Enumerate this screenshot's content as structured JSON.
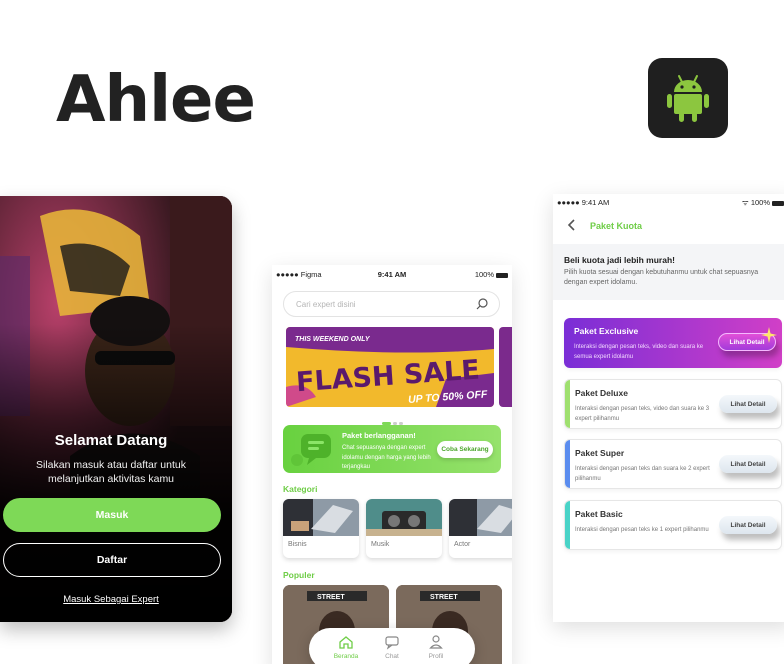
{
  "app_title": "Ahlee",
  "platform_icon": "android-icon",
  "colors": {
    "accent_green": "#7ed957",
    "exclusive_purple": "#9b36d4"
  },
  "welcome_screen": {
    "title": "Selamat Datang",
    "subtitle": "Silakan masuk atau daftar untuk melanjutkan aktivitas kamu",
    "login_button": "Masuk",
    "register_button": "Daftar",
    "expert_link": "Masuk Sebagai Expert"
  },
  "home_screen": {
    "status": {
      "carrier": "Figma",
      "time": "9:41 AM",
      "battery": "100%"
    },
    "search_placeholder": "Cari expert disini",
    "banner": {
      "tag": "THIS WEEKEND ONLY",
      "headline": "FLASH SALE",
      "discount": "UP TO 50% OFF"
    },
    "carousel": {
      "count": 3,
      "active_index": 0
    },
    "promo": {
      "title": "Paket berlangganan!",
      "description": "Chat sepuasnya dengan expert idolamu dengan harga yang lebih terjangkau",
      "button": "Coba Sekarang"
    },
    "category_heading": "Kategori",
    "categories": [
      {
        "label": "Bisnis"
      },
      {
        "label": "Musik"
      },
      {
        "label": "Actor"
      }
    ],
    "popular_heading": "Populer",
    "popular_sign": "STREET",
    "nav": [
      {
        "label": "Beranda",
        "icon": "home-icon",
        "active": true
      },
      {
        "label": "Chat",
        "icon": "chat-icon",
        "active": false
      },
      {
        "label": "Profil",
        "icon": "user-icon",
        "active": false
      }
    ]
  },
  "quota_screen": {
    "status": {
      "time": "9:41 AM",
      "battery": "100%"
    },
    "title": "Paket Kuota",
    "info_heading": "Beli kuota jadi lebih murah!",
    "info_text": "Pilih kuota sesuai dengan kebutuhanmu untuk chat sepuasnya dengan expert idolamu.",
    "packages": [
      {
        "name": "Paket Exclusive",
        "desc": "Interaksi dengan pesan teks, video dan suara ke semua expert idolamu",
        "button": "Lihat Detail",
        "color": "#9b36d4"
      },
      {
        "name": "Paket Deluxe",
        "desc": "Interaksi dengan pesan teks, video dan suara ke 3 expert pilihanmu",
        "button": "Lihat Detail",
        "color": "#9fe06f"
      },
      {
        "name": "Paket Super",
        "desc": "Interaksi dengan pesan teks dan suara ke 2 expert pilihanmu",
        "button": "Lihat Detail",
        "color": "#5b8def"
      },
      {
        "name": "Paket Basic",
        "desc": "Interaksi dengan pesan teks ke 1 expert pilihanmu",
        "button": "Lihat Detail",
        "color": "#49d3c7"
      }
    ]
  }
}
